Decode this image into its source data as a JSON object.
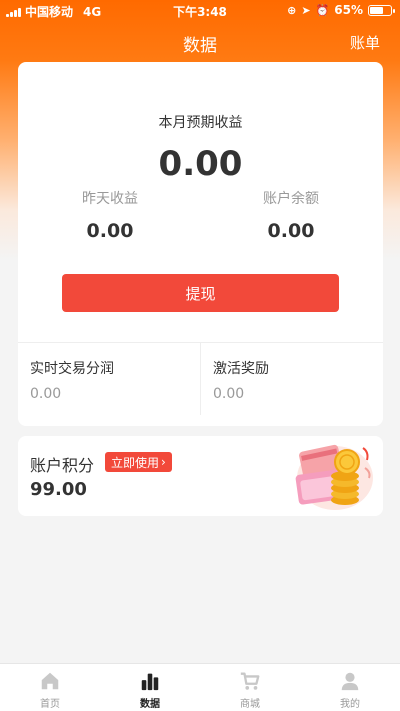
{
  "status_bar": {
    "carrier": "中国移动",
    "network": "4G",
    "time": "下午3:48",
    "battery": "65%",
    "battery_level": 0.65
  },
  "nav": {
    "title": "数据",
    "right_action": "账单"
  },
  "earnings": {
    "month_label": "本月预期收益",
    "month_value": "0.00",
    "yesterday_label": "昨天收益",
    "yesterday_value": "0.00",
    "balance_label": "账户余额",
    "balance_value": "0.00",
    "withdraw_label": "提现"
  },
  "details": {
    "realtime_label": "实时交易分润",
    "realtime_value": "0.00",
    "activation_label": "激活奖励",
    "activation_value": "0.00"
  },
  "points": {
    "title": "账户积分",
    "action_label": "立即使用",
    "value": "99.00"
  },
  "tabs": [
    {
      "label": "首页",
      "icon": "home-icon",
      "active": false
    },
    {
      "label": "数据",
      "icon": "bar-chart-icon",
      "active": true
    },
    {
      "label": "商城",
      "icon": "cart-icon",
      "active": false
    },
    {
      "label": "我的",
      "icon": "user-icon",
      "active": false
    }
  ],
  "colors": {
    "brand_orange": "#ff6a00",
    "accent_red": "#f2493a",
    "text_dark": "#333333",
    "text_muted": "#999999"
  }
}
